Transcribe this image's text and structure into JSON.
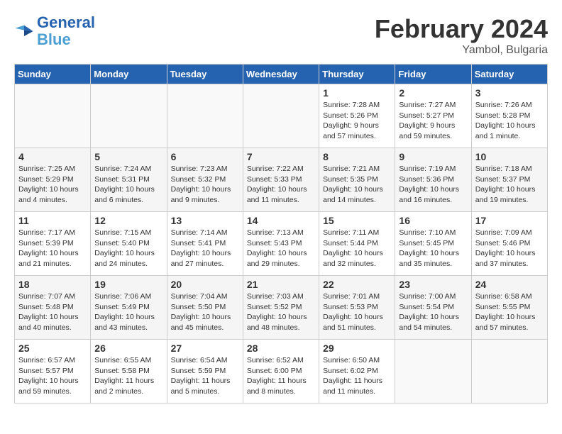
{
  "header": {
    "logo_general": "General",
    "logo_blue": "Blue",
    "main_title": "February 2024",
    "subtitle": "Yambol, Bulgaria"
  },
  "days_of_week": [
    "Sunday",
    "Monday",
    "Tuesday",
    "Wednesday",
    "Thursday",
    "Friday",
    "Saturday"
  ],
  "weeks": [
    {
      "days": [
        {
          "num": "",
          "info": ""
        },
        {
          "num": "",
          "info": ""
        },
        {
          "num": "",
          "info": ""
        },
        {
          "num": "",
          "info": ""
        },
        {
          "num": "1",
          "info": "Sunrise: 7:28 AM\nSunset: 5:26 PM\nDaylight: 9 hours\nand 57 minutes."
        },
        {
          "num": "2",
          "info": "Sunrise: 7:27 AM\nSunset: 5:27 PM\nDaylight: 9 hours\nand 59 minutes."
        },
        {
          "num": "3",
          "info": "Sunrise: 7:26 AM\nSunset: 5:28 PM\nDaylight: 10 hours\nand 1 minute."
        }
      ]
    },
    {
      "days": [
        {
          "num": "4",
          "info": "Sunrise: 7:25 AM\nSunset: 5:29 PM\nDaylight: 10 hours\nand 4 minutes."
        },
        {
          "num": "5",
          "info": "Sunrise: 7:24 AM\nSunset: 5:31 PM\nDaylight: 10 hours\nand 6 minutes."
        },
        {
          "num": "6",
          "info": "Sunrise: 7:23 AM\nSunset: 5:32 PM\nDaylight: 10 hours\nand 9 minutes."
        },
        {
          "num": "7",
          "info": "Sunrise: 7:22 AM\nSunset: 5:33 PM\nDaylight: 10 hours\nand 11 minutes."
        },
        {
          "num": "8",
          "info": "Sunrise: 7:21 AM\nSunset: 5:35 PM\nDaylight: 10 hours\nand 14 minutes."
        },
        {
          "num": "9",
          "info": "Sunrise: 7:19 AM\nSunset: 5:36 PM\nDaylight: 10 hours\nand 16 minutes."
        },
        {
          "num": "10",
          "info": "Sunrise: 7:18 AM\nSunset: 5:37 PM\nDaylight: 10 hours\nand 19 minutes."
        }
      ]
    },
    {
      "days": [
        {
          "num": "11",
          "info": "Sunrise: 7:17 AM\nSunset: 5:39 PM\nDaylight: 10 hours\nand 21 minutes."
        },
        {
          "num": "12",
          "info": "Sunrise: 7:15 AM\nSunset: 5:40 PM\nDaylight: 10 hours\nand 24 minutes."
        },
        {
          "num": "13",
          "info": "Sunrise: 7:14 AM\nSunset: 5:41 PM\nDaylight: 10 hours\nand 27 minutes."
        },
        {
          "num": "14",
          "info": "Sunrise: 7:13 AM\nSunset: 5:43 PM\nDaylight: 10 hours\nand 29 minutes."
        },
        {
          "num": "15",
          "info": "Sunrise: 7:11 AM\nSunset: 5:44 PM\nDaylight: 10 hours\nand 32 minutes."
        },
        {
          "num": "16",
          "info": "Sunrise: 7:10 AM\nSunset: 5:45 PM\nDaylight: 10 hours\nand 35 minutes."
        },
        {
          "num": "17",
          "info": "Sunrise: 7:09 AM\nSunset: 5:46 PM\nDaylight: 10 hours\nand 37 minutes."
        }
      ]
    },
    {
      "days": [
        {
          "num": "18",
          "info": "Sunrise: 7:07 AM\nSunset: 5:48 PM\nDaylight: 10 hours\nand 40 minutes."
        },
        {
          "num": "19",
          "info": "Sunrise: 7:06 AM\nSunset: 5:49 PM\nDaylight: 10 hours\nand 43 minutes."
        },
        {
          "num": "20",
          "info": "Sunrise: 7:04 AM\nSunset: 5:50 PM\nDaylight: 10 hours\nand 45 minutes."
        },
        {
          "num": "21",
          "info": "Sunrise: 7:03 AM\nSunset: 5:52 PM\nDaylight: 10 hours\nand 48 minutes."
        },
        {
          "num": "22",
          "info": "Sunrise: 7:01 AM\nSunset: 5:53 PM\nDaylight: 10 hours\nand 51 minutes."
        },
        {
          "num": "23",
          "info": "Sunrise: 7:00 AM\nSunset: 5:54 PM\nDaylight: 10 hours\nand 54 minutes."
        },
        {
          "num": "24",
          "info": "Sunrise: 6:58 AM\nSunset: 5:55 PM\nDaylight: 10 hours\nand 57 minutes."
        }
      ]
    },
    {
      "days": [
        {
          "num": "25",
          "info": "Sunrise: 6:57 AM\nSunset: 5:57 PM\nDaylight: 10 hours\nand 59 minutes."
        },
        {
          "num": "26",
          "info": "Sunrise: 6:55 AM\nSunset: 5:58 PM\nDaylight: 11 hours\nand 2 minutes."
        },
        {
          "num": "27",
          "info": "Sunrise: 6:54 AM\nSunset: 5:59 PM\nDaylight: 11 hours\nand 5 minutes."
        },
        {
          "num": "28",
          "info": "Sunrise: 6:52 AM\nSunset: 6:00 PM\nDaylight: 11 hours\nand 8 minutes."
        },
        {
          "num": "29",
          "info": "Sunrise: 6:50 AM\nSunset: 6:02 PM\nDaylight: 11 hours\nand 11 minutes."
        },
        {
          "num": "",
          "info": ""
        },
        {
          "num": "",
          "info": ""
        }
      ]
    }
  ]
}
